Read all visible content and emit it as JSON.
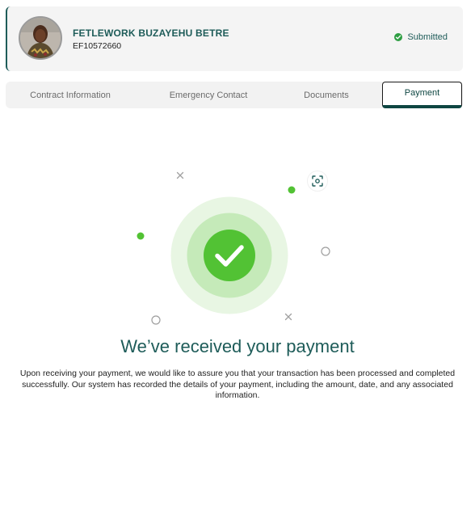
{
  "profile": {
    "name": "FETLEWORK BUZAYEHU BETRE",
    "employee_id": "EF10572660",
    "status": "Submitted",
    "status_color": "#2e9e43"
  },
  "tabs": [
    {
      "label": "Contract Information",
      "active": false
    },
    {
      "label": "Emergency Contact",
      "active": false
    },
    {
      "label": "Documents",
      "active": false
    },
    {
      "label": "Payment",
      "active": true
    }
  ],
  "success": {
    "title": "We’ve received your payment",
    "description": "Upon receiving your payment, we would like to assure you that your transaction has been processed and completed successfully. Our system has recorded the details of your payment, including the amount, date, and any associated information."
  },
  "colors": {
    "primary": "#1e5c59",
    "success_green": "#52c234",
    "ring_light": "#e8f6e3",
    "ring_mid": "#c5eab9"
  }
}
